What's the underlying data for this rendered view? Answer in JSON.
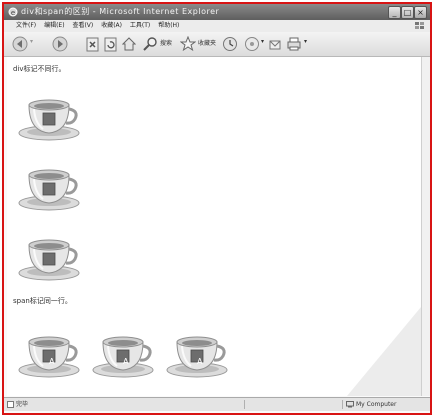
{
  "window": {
    "title": "div和span的区别 - Microsoft Internet Explorer",
    "min_label": "_",
    "max_label": "□",
    "close_label": "×"
  },
  "menu": {
    "items": [
      "文件(F)",
      "编辑(E)",
      "查看(V)",
      "收藏(A)",
      "工具(T)",
      "帮助(H)"
    ]
  },
  "toolbar": {
    "search_label": "搜索",
    "favorites_label": "收藏夹",
    "icons": [
      "back-icon",
      "forward-icon",
      "stop-icon",
      "refresh-icon",
      "home-icon",
      "search-icon",
      "favorites-star-icon",
      "history-icon",
      "mail-icon",
      "print-icon"
    ]
  },
  "content": {
    "div_label": "div标记不同行。",
    "span_label": "span标记同一行。",
    "cup_letter": "A"
  },
  "status": {
    "left": "完毕",
    "right": "My Computer"
  }
}
